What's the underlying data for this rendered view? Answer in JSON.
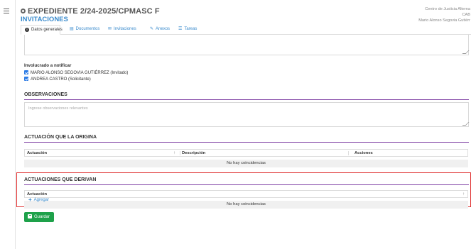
{
  "header": {
    "title": "EXPEDIENTE 2/24-2025/CPMASC F",
    "subtitle": "INVITACIONES",
    "org_lines": [
      "Centro de Justicia Alterna",
      "CAB",
      "Mario Alonso Segovia Gutiérr"
    ]
  },
  "tabs": [
    {
      "label": "Datos generales",
      "icon": "info-circle-icon",
      "active": true
    },
    {
      "label": "Documentos",
      "icon": "document-icon",
      "active": false
    },
    {
      "label": "Invitaciones",
      "icon": "envelope-icon",
      "active": false
    },
    {
      "label": "Anexos",
      "icon": "paperclip-icon",
      "active": false
    },
    {
      "label": "Tareas",
      "icon": "list-icon",
      "active": false
    }
  ],
  "involved": {
    "title": "Involucrado a notificar",
    "items": [
      {
        "label": "MARIO ALONSO SEGOVIA GUTIÉRREZ (Invitado)",
        "checked": true
      },
      {
        "label": "ANDREA CASTRO (Solicitante)",
        "checked": true
      }
    ]
  },
  "observaciones": {
    "title": "OBSERVACIONES",
    "placeholder": "Ingrese observaciones relevantes"
  },
  "origina": {
    "title": "ACTUACIÓN QUE LA ORIGINA",
    "columns": [
      "Actuación",
      "Descripción",
      "Acciones"
    ],
    "empty": "No hay coincidencias"
  },
  "derivan": {
    "title": "ACTUACIONES QUE DERIVAN",
    "columns": [
      "Actuación"
    ],
    "empty": "No hay coincidencias",
    "add_label": "Agregar"
  },
  "save_label": "Guardar",
  "colors": {
    "accent": "#3a8bcd",
    "section_rule": "#7e3ea3",
    "highlight": "#e03131",
    "save": "#1ea14a"
  }
}
